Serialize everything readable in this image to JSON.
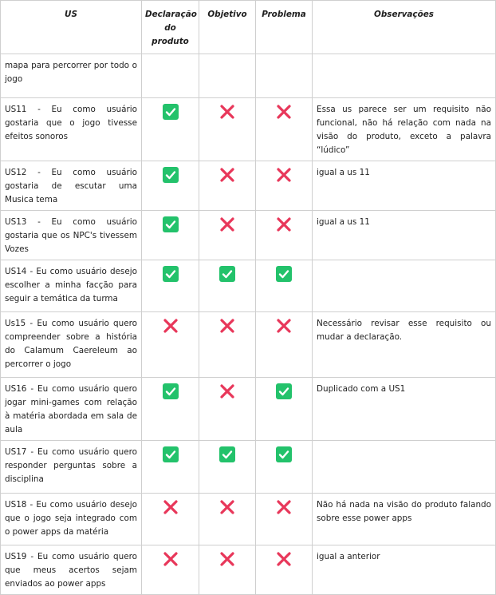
{
  "headers": {
    "us": "US",
    "declaracao_line1": "Declaração",
    "declaracao_line2": "do produto",
    "objetivo": "Objetivo",
    "problema": "Problema",
    "observacoes": "Observações"
  },
  "colors": {
    "check": "#23c26b",
    "cross": "#e8375a"
  },
  "rows": [
    {
      "us": "mapa para percorrer por todo o jogo",
      "declaracao": "",
      "objetivo": "",
      "problema": "",
      "obs": ""
    },
    {
      "us": "US11 - Eu como usuário gostaria que o jogo tivesse efeitos sonoros",
      "declaracao": "check",
      "objetivo": "cross",
      "problema": "cross",
      "obs": "Essa us parece ser um requisito não funcional, não há relação com nada na visão do produto, exceto a palavra “lúdico”"
    },
    {
      "us": "US12 - Eu como usuário gostaria de escutar uma Musica tema",
      "declaracao": "check",
      "objetivo": "cross",
      "problema": "cross",
      "obs": "igual a us 11"
    },
    {
      "us": "US13 - Eu como usuário gostaria que os NPC's tivessem Vozes",
      "declaracao": "check",
      "objetivo": "cross",
      "problema": "cross",
      "obs": "igual a us 11"
    },
    {
      "us": "US14 - Eu como usuário desejo escolher a minha facção para seguir a temática da turma",
      "declaracao": "check",
      "objetivo": "check",
      "problema": "check",
      "obs": ""
    },
    {
      "us": "Us15 - Eu como usuário quero compreender sobre a história do Calamum Caereleum ao percorrer o jogo",
      "declaracao": "cross",
      "objetivo": "cross",
      "problema": "cross",
      "obs": "Necessário revisar esse requisito ou mudar a declaração."
    },
    {
      "us": "US16 - Eu como usuário quero jogar mini-games com relação à matéria abordada em sala de aula",
      "declaracao": "check",
      "objetivo": "cross",
      "problema": "check",
      "obs": "Duplicado com a US1"
    },
    {
      "us": "US17 - Eu como usuário quero responder perguntas sobre a disciplina",
      "declaracao": "check",
      "objetivo": "check",
      "problema": "check",
      "obs": ""
    },
    {
      "us": "US18 - Eu como usuário desejo que o jogo seja integrado com o power apps da matéria",
      "declaracao": "cross",
      "objetivo": "cross",
      "problema": "cross",
      "obs": "Não há nada na visão do produto falando sobre esse power apps"
    },
    {
      "us": "US19 - Eu como usuário quero que meus acertos sejam enviados ao power apps",
      "declaracao": "cross",
      "objetivo": "cross",
      "problema": "cross",
      "obs": "igual a anterior"
    }
  ]
}
